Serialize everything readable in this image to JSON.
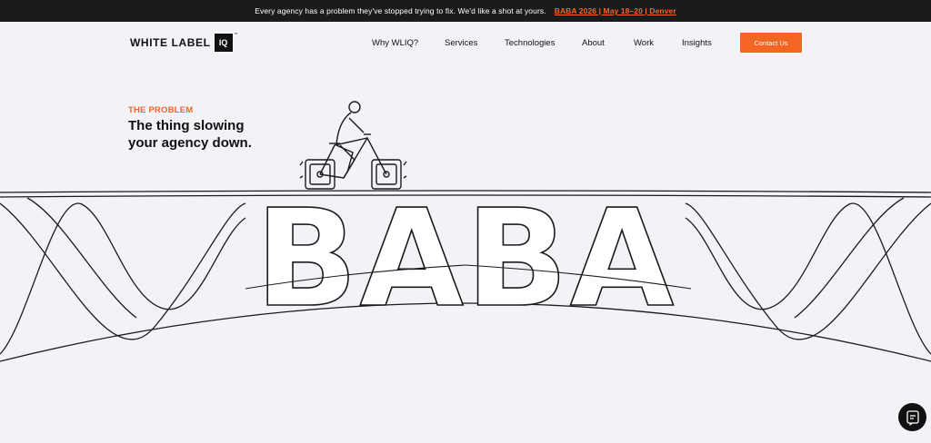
{
  "announcement": {
    "message": "Every agency has a problem they've stopped trying to fix. We'd like a shot at yours.",
    "link": "BABA 2026 | May 18–20 | Denver"
  },
  "brand": {
    "name": "WHITE LABEL",
    "mark": "IQ",
    "tm": "™"
  },
  "nav": {
    "items": [
      "Why WLIQ?",
      "Services",
      "Technologies",
      "About",
      "Work",
      "Insights"
    ],
    "cta": "Contact Us"
  },
  "hero": {
    "eyebrow": "THE PROBLEM",
    "headline_line1": "The thing slowing",
    "headline_line2": "your agency down.",
    "art_word": "BABA"
  },
  "icons": {
    "chat": "chat-icon"
  },
  "colors": {
    "accent": "#f26522",
    "background": "#f3f2f7",
    "dark": "#1b1b1b"
  }
}
